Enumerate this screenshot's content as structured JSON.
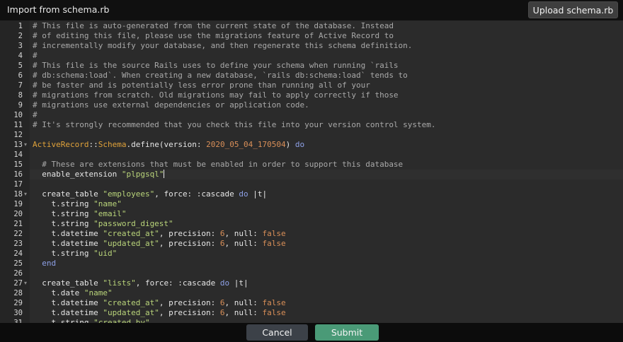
{
  "header": {
    "title": "Import from schema.rb",
    "upload_label": "Upload schema.rb"
  },
  "editor": {
    "lines": [
      {
        "n": "1",
        "fold": false,
        "tokens": [
          {
            "c": "cm",
            "t": "# This file is auto-generated from the current state of the database. Instead"
          }
        ]
      },
      {
        "n": "2",
        "fold": false,
        "tokens": [
          {
            "c": "cm",
            "t": "# of editing this file, please use the migrations feature of Active Record to"
          }
        ]
      },
      {
        "n": "3",
        "fold": false,
        "tokens": [
          {
            "c": "cm",
            "t": "# incrementally modify your database, and then regenerate this schema definition."
          }
        ]
      },
      {
        "n": "4",
        "fold": false,
        "tokens": [
          {
            "c": "cm",
            "t": "#"
          }
        ]
      },
      {
        "n": "5",
        "fold": false,
        "tokens": [
          {
            "c": "cm",
            "t": "# This file is the source Rails uses to define your schema when running `rails"
          }
        ]
      },
      {
        "n": "6",
        "fold": false,
        "tokens": [
          {
            "c": "cm",
            "t": "# db:schema:load`. When creating a new database, `rails db:schema:load` tends to"
          }
        ]
      },
      {
        "n": "7",
        "fold": false,
        "tokens": [
          {
            "c": "cm",
            "t": "# be faster and is potentially less error prone than running all of your"
          }
        ]
      },
      {
        "n": "8",
        "fold": false,
        "tokens": [
          {
            "c": "cm",
            "t": "# migrations from scratch. Old migrations may fail to apply correctly if those"
          }
        ]
      },
      {
        "n": "9",
        "fold": false,
        "tokens": [
          {
            "c": "cm",
            "t": "# migrations use external dependencies or application code."
          }
        ]
      },
      {
        "n": "10",
        "fold": false,
        "tokens": [
          {
            "c": "cm",
            "t": "#"
          }
        ]
      },
      {
        "n": "11",
        "fold": false,
        "tokens": [
          {
            "c": "cm",
            "t": "# It's strongly recommended that you check this file into your version control system."
          }
        ]
      },
      {
        "n": "12",
        "fold": false,
        "tokens": []
      },
      {
        "n": "13",
        "fold": true,
        "tokens": [
          {
            "c": "cls",
            "t": "ActiveRecord"
          },
          {
            "c": "sym",
            "t": "::"
          },
          {
            "c": "cls",
            "t": "Schema"
          },
          {
            "c": "sym",
            "t": ".define(version: "
          },
          {
            "c": "num",
            "t": "2020_05_04_170504"
          },
          {
            "c": "sym",
            "t": ") "
          },
          {
            "c": "kw",
            "t": "do"
          }
        ]
      },
      {
        "n": "14",
        "fold": false,
        "tokens": []
      },
      {
        "n": "15",
        "fold": false,
        "tokens": [
          {
            "c": "cm",
            "t": "  # These are extensions that must be enabled in order to support this database"
          }
        ]
      },
      {
        "n": "16",
        "fold": false,
        "active": true,
        "tokens": [
          {
            "c": "sym",
            "t": "  enable_extension "
          },
          {
            "c": "str",
            "t": "\"plpgsql\""
          }
        ]
      },
      {
        "n": "17",
        "fold": false,
        "tokens": []
      },
      {
        "n": "18",
        "fold": true,
        "tokens": [
          {
            "c": "sym",
            "t": "  create_table "
          },
          {
            "c": "str",
            "t": "\"employees\""
          },
          {
            "c": "sym",
            "t": ", force: :cascade "
          },
          {
            "c": "kw",
            "t": "do"
          },
          {
            "c": "sym",
            "t": " |t|"
          }
        ]
      },
      {
        "n": "19",
        "fold": false,
        "tokens": [
          {
            "c": "sym",
            "t": "    t.string "
          },
          {
            "c": "str",
            "t": "\"name\""
          }
        ]
      },
      {
        "n": "20",
        "fold": false,
        "tokens": [
          {
            "c": "sym",
            "t": "    t.string "
          },
          {
            "c": "str",
            "t": "\"email\""
          }
        ]
      },
      {
        "n": "21",
        "fold": false,
        "tokens": [
          {
            "c": "sym",
            "t": "    t.string "
          },
          {
            "c": "str",
            "t": "\"password_digest\""
          }
        ]
      },
      {
        "n": "22",
        "fold": false,
        "tokens": [
          {
            "c": "sym",
            "t": "    t.datetime "
          },
          {
            "c": "str",
            "t": "\"created_at\""
          },
          {
            "c": "sym",
            "t": ", precision: "
          },
          {
            "c": "num",
            "t": "6"
          },
          {
            "c": "sym",
            "t": ", null: "
          },
          {
            "c": "num",
            "t": "false"
          }
        ]
      },
      {
        "n": "23",
        "fold": false,
        "tokens": [
          {
            "c": "sym",
            "t": "    t.datetime "
          },
          {
            "c": "str",
            "t": "\"updated_at\""
          },
          {
            "c": "sym",
            "t": ", precision: "
          },
          {
            "c": "num",
            "t": "6"
          },
          {
            "c": "sym",
            "t": ", null: "
          },
          {
            "c": "num",
            "t": "false"
          }
        ]
      },
      {
        "n": "24",
        "fold": false,
        "tokens": [
          {
            "c": "sym",
            "t": "    t.string "
          },
          {
            "c": "str",
            "t": "\"uid\""
          }
        ]
      },
      {
        "n": "25",
        "fold": false,
        "tokens": [
          {
            "c": "kw",
            "t": "  end"
          }
        ]
      },
      {
        "n": "26",
        "fold": false,
        "tokens": []
      },
      {
        "n": "27",
        "fold": true,
        "tokens": [
          {
            "c": "sym",
            "t": "  create_table "
          },
          {
            "c": "str",
            "t": "\"lists\""
          },
          {
            "c": "sym",
            "t": ", force: :cascade "
          },
          {
            "c": "kw",
            "t": "do"
          },
          {
            "c": "sym",
            "t": " |t|"
          }
        ]
      },
      {
        "n": "28",
        "fold": false,
        "tokens": [
          {
            "c": "sym",
            "t": "    t.date "
          },
          {
            "c": "str",
            "t": "\"name\""
          }
        ]
      },
      {
        "n": "29",
        "fold": false,
        "tokens": [
          {
            "c": "sym",
            "t": "    t.datetime "
          },
          {
            "c": "str",
            "t": "\"created_at\""
          },
          {
            "c": "sym",
            "t": ", precision: "
          },
          {
            "c": "num",
            "t": "6"
          },
          {
            "c": "sym",
            "t": ", null: "
          },
          {
            "c": "num",
            "t": "false"
          }
        ]
      },
      {
        "n": "30",
        "fold": false,
        "tokens": [
          {
            "c": "sym",
            "t": "    t.datetime "
          },
          {
            "c": "str",
            "t": "\"updated_at\""
          },
          {
            "c": "sym",
            "t": ", precision: "
          },
          {
            "c": "num",
            "t": "6"
          },
          {
            "c": "sym",
            "t": ", null: "
          },
          {
            "c": "num",
            "t": "false"
          }
        ]
      },
      {
        "n": "31",
        "fold": false,
        "tokens": [
          {
            "c": "sym",
            "t": "    t.string "
          },
          {
            "c": "str",
            "t": "\"created_by\""
          }
        ]
      }
    ]
  },
  "footer": {
    "cancel_label": "Cancel",
    "submit_label": "Submit"
  },
  "colors": {
    "submit": "#4a9a77",
    "cancel": "#3c4148",
    "comment": "#a9a9a9",
    "string": "#b9d47a",
    "number": "#d98f58",
    "keyword": "#8da0e6",
    "class": "#e0a23a"
  },
  "icons": {
    "fold": "fold-arrow-icon"
  }
}
